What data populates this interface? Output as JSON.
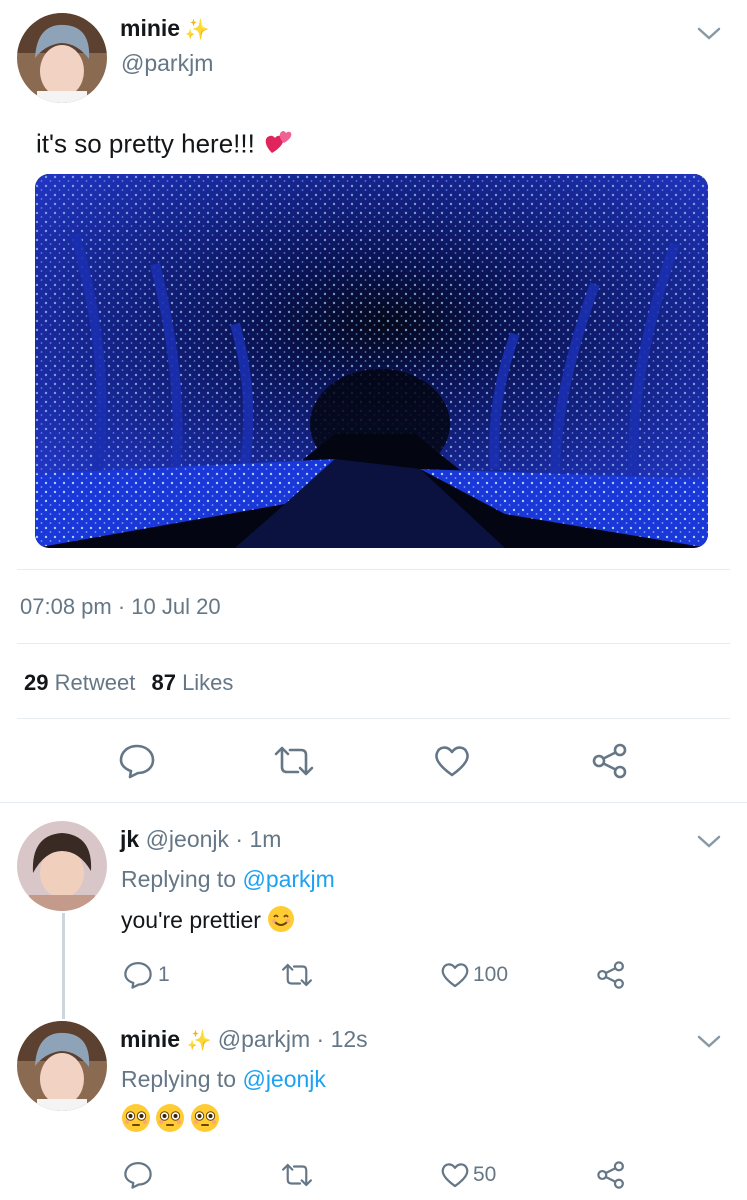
{
  "main_tweet": {
    "display_name": "minie",
    "handle": "@parkjm",
    "text": "it's so pretty here!!!",
    "timestamp": "07:08 pm · 10 Jul 20",
    "retweet_count": "29",
    "retweet_label": "Retweet",
    "like_count": "87",
    "like_label": "Likes"
  },
  "replies": [
    {
      "display_name": "jk",
      "handle": "@jeonjk",
      "time": "· 1m",
      "replying_prefix": "Replying to",
      "replying_to": "@parkjm",
      "text": "you're prettier",
      "reply_count": "1",
      "like_count": "100"
    },
    {
      "display_name": "minie",
      "handle": "@parkjm",
      "time": "· 12s",
      "replying_prefix": "Replying to",
      "replying_to": "@jeonjk",
      "text": "",
      "reply_count": "",
      "like_count": "50"
    }
  ],
  "icons": {
    "reply": "reply-icon",
    "retweet": "retweet-icon",
    "like": "heart-icon",
    "share": "share-icon",
    "more": "chevron-down-icon",
    "sparkle": "sparkles-icon",
    "hearts": "revolving-hearts-icon",
    "smile": "smiling-face-icon",
    "flushed": "flushed-face-icon"
  },
  "colors": {
    "accent": "#1da1f2",
    "text_secondary": "#657786",
    "divider": "#e6ecf0",
    "image_glow": "#1e4fff"
  }
}
